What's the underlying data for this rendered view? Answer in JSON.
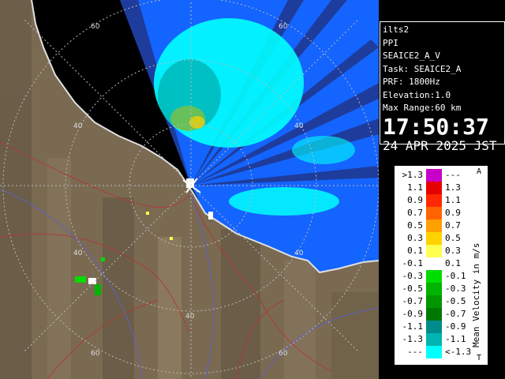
{
  "info": {
    "site": "ilts2",
    "product": "PPI",
    "scan": "SEAICE2_A_V",
    "task": "Task: SEAICE2_A",
    "prf": "PRF: 1800Hz",
    "elevation": "Elevation:1.0",
    "max_range": "Max Range:60 km",
    "time": "17:50:37",
    "date": "24 APR 2025 JST"
  },
  "range_rings": {
    "labels": [
      "60",
      "60",
      "40",
      "40",
      "40",
      "40",
      "40",
      "60",
      "60"
    ]
  },
  "legend": {
    "title": "Mean Velocity in m/s",
    "top_marker": "A",
    "bottom_marker": "T",
    "rows": [
      {
        "lo": ">1.3",
        "hi": "---",
        "color": "#c800c8"
      },
      {
        "lo": "1.1",
        "hi": "1.3",
        "color": "#e60000"
      },
      {
        "lo": "0.9",
        "hi": "1.1",
        "color": "#ff2800"
      },
      {
        "lo": "0.7",
        "hi": "0.9",
        "color": "#ff6400"
      },
      {
        "lo": "0.5",
        "hi": "0.7",
        "color": "#ffa000"
      },
      {
        "lo": "0.3",
        "hi": "0.5",
        "color": "#ffd200"
      },
      {
        "lo": "0.1",
        "hi": "0.3",
        "color": "#ffff50"
      },
      {
        "lo": "-0.1",
        "hi": "0.1",
        "color": "#ffffff"
      },
      {
        "lo": "-0.3",
        "hi": "-0.1",
        "color": "#00dc00"
      },
      {
        "lo": "-0.5",
        "hi": "-0.3",
        "color": "#00b400"
      },
      {
        "lo": "-0.7",
        "hi": "-0.5",
        "color": "#009600"
      },
      {
        "lo": "-0.9",
        "hi": "-0.7",
        "color": "#007800"
      },
      {
        "lo": "-1.1",
        "hi": "-0.9",
        "color": "#008c8c"
      },
      {
        "lo": "-1.3",
        "hi": "-1.1",
        "color": "#00b4b4"
      },
      {
        "lo": "---",
        "hi": "<-1.3",
        "color": "#00ffff"
      }
    ]
  }
}
